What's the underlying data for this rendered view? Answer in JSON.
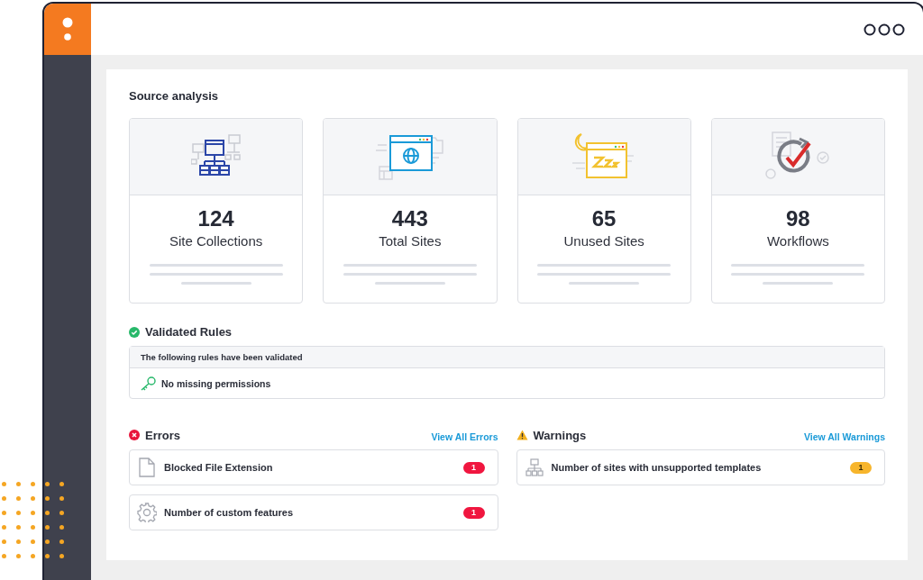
{
  "title": "Source analysis",
  "stats": [
    {
      "value": "124",
      "label": "Site Collections",
      "kind": "sitemap"
    },
    {
      "value": "443",
      "label": "Total Sites",
      "kind": "browser"
    },
    {
      "value": "65",
      "label": "Unused Sites",
      "kind": "sleep"
    },
    {
      "value": "98",
      "label": "Workflows",
      "kind": "workflow"
    }
  ],
  "validated": {
    "title": "Validated Rules",
    "header": "The following rules have been validated",
    "items": [
      "No missing permissions"
    ]
  },
  "sections": [
    {
      "kind": "error",
      "title": "Errors",
      "link": "View All Errors",
      "items": [
        {
          "label": "Blocked File Extension",
          "count": "1",
          "kind": "file"
        },
        {
          "label": "Number of custom features",
          "count": "1",
          "kind": "gear"
        }
      ]
    },
    {
      "kind": "warning",
      "title": "Warnings",
      "link": "View All Warnings",
      "items": [
        {
          "label": "Number of sites with unsupported templates",
          "count": "1",
          "kind": "sitemap"
        }
      ]
    }
  ]
}
